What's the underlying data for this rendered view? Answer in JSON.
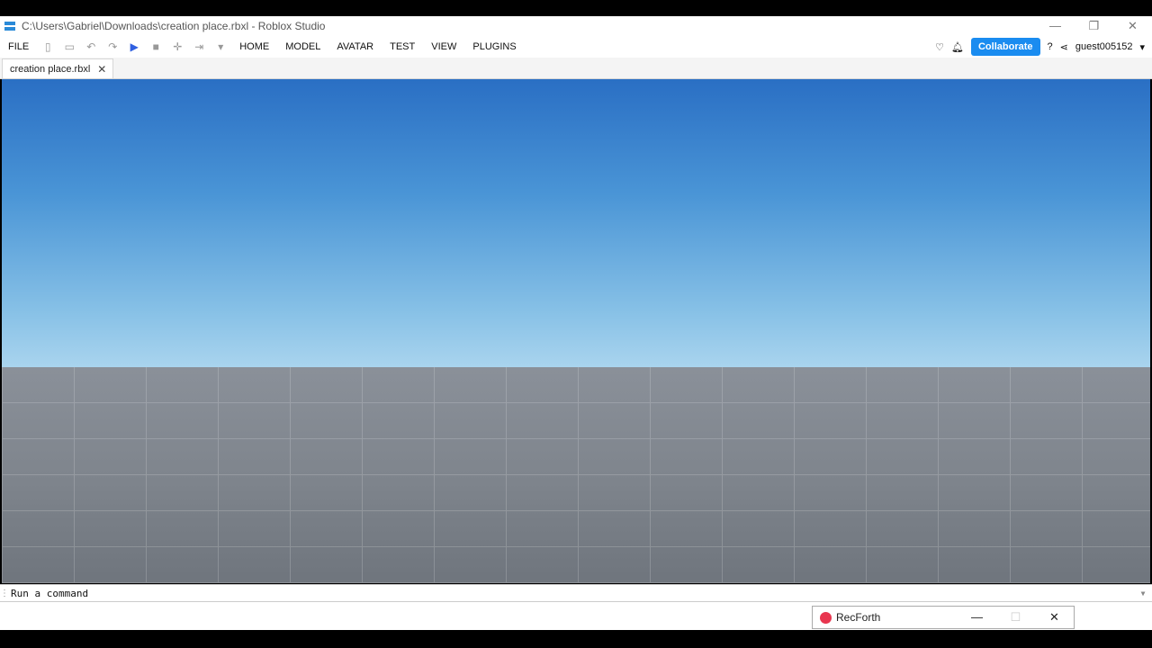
{
  "window": {
    "title": "C:\\Users\\Gabriel\\Downloads\\creation place.rbxl - Roblox Studio",
    "minimize": "—",
    "restore": "❐",
    "close": "✕"
  },
  "menubar": {
    "file": "FILE",
    "home": "HOME",
    "model": "MODEL",
    "avatar": "AVATAR",
    "test": "TEST",
    "view": "VIEW",
    "plugins": "PLUGINS",
    "collaborate": "Collaborate",
    "user": "guest005152"
  },
  "tab": {
    "label": "creation place.rbxl",
    "close": "✕"
  },
  "command_bar": {
    "placeholder": "Run a command"
  },
  "taskbar": {
    "label": "RecForth",
    "minimize": "—",
    "maximize": "☐",
    "close": "✕"
  },
  "colors": {
    "accent": "#1a8cf0",
    "play": "#2f5fe0",
    "rec": "#e8364f"
  }
}
